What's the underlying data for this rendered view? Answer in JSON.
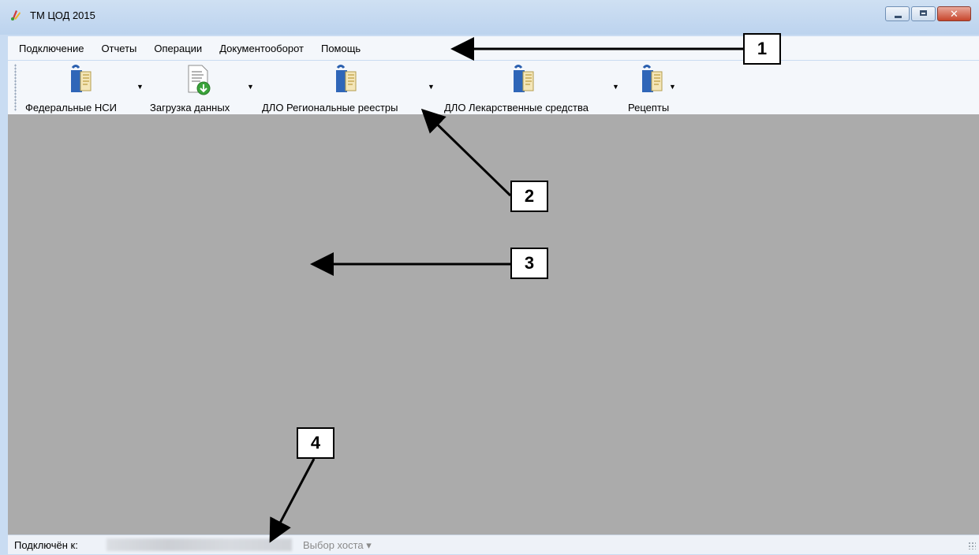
{
  "window": {
    "title": "ТМ ЦОД 2015",
    "close_glyph": "✕"
  },
  "menu": [
    {
      "label": "Подключение"
    },
    {
      "label": "Отчеты"
    },
    {
      "label": "Операции"
    },
    {
      "label": "Документооборот"
    },
    {
      "label": "Помощь"
    }
  ],
  "toolbar": {
    "buttons": [
      {
        "label": "Федеральные НСИ",
        "icon": "package-book-icon"
      },
      {
        "label": "Загрузка данных",
        "icon": "document-download-icon"
      },
      {
        "label": "ДЛО Региональные реестры",
        "icon": "package-book-icon"
      },
      {
        "label": "ДЛО Лекарственные средства",
        "icon": "package-book-icon"
      },
      {
        "label": "Рецепты",
        "icon": "package-book-icon"
      }
    ],
    "dropdown_glyph": "▼"
  },
  "statusbar": {
    "connected_label": "Подключён к:",
    "host_select": "Выбор хоста ▾"
  },
  "callouts": [
    "1",
    "2",
    "3",
    "4"
  ],
  "colors": {
    "client_area": "#ababab",
    "title_bar": "#c9dcf2",
    "close_button": "#c7452b"
  }
}
